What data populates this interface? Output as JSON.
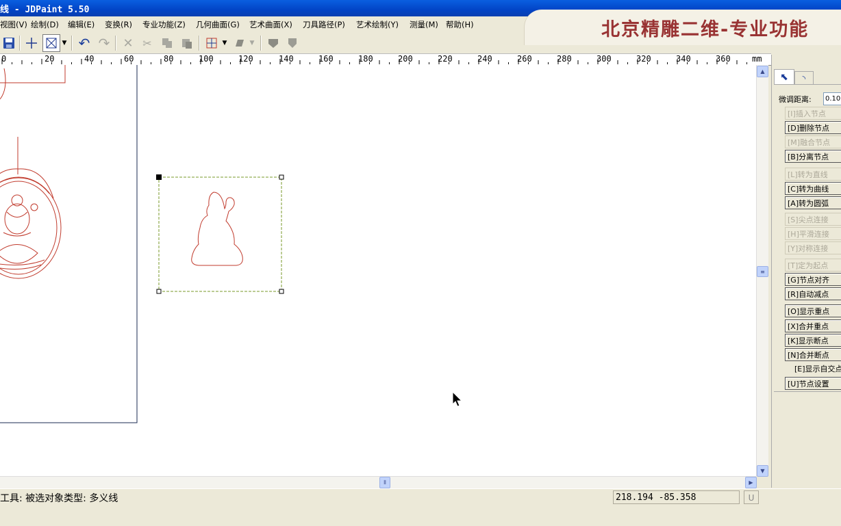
{
  "window": {
    "title": "线 - JDPaint 5.50"
  },
  "banner": {
    "text": "北京精雕二维-专业功能"
  },
  "menu": [
    {
      "label": "视图(V)"
    },
    {
      "label": "绘制(D)"
    },
    {
      "label": "编辑(E)"
    },
    {
      "label": "变换(R)"
    },
    {
      "label": "专业功能(Z)"
    },
    {
      "label": "几何曲面(G)"
    },
    {
      "label": "艺术曲面(X)"
    },
    {
      "label": "刀具路径(P)"
    },
    {
      "label": "艺术绘制(Y)"
    },
    {
      "label": "测量(M)"
    },
    {
      "label": "帮助(H)"
    }
  ],
  "toolbar": {
    "icons": [
      "save-icon",
      "crosshair-icon",
      "select-box-icon",
      "dropdown-arrow-icon",
      "undo-icon",
      "redo-icon",
      "delete-icon",
      "cut-icon",
      "copy-icon",
      "paste-icon",
      "grid-snap-icon",
      "fill-shape-icon",
      "node-edit-icon",
      "shield-icon"
    ]
  },
  "ruler": {
    "labels": [
      "0",
      "20",
      "40",
      "60",
      "80",
      "100",
      "120",
      "140",
      "160",
      "180",
      "200",
      "220",
      "240",
      "260",
      "280",
      "300",
      "320",
      "340",
      "360",
      "mm"
    ]
  },
  "panel": {
    "fine_tune_label": "微调距离:",
    "fine_tune_value": "0.10",
    "buttons": [
      {
        "label": "[I]插入节点",
        "enabled": false
      },
      {
        "label": "[D]删除节点",
        "enabled": true
      },
      {
        "label": "[M]融合节点",
        "enabled": false
      },
      {
        "label": "[B]分离节点",
        "enabled": true
      },
      {
        "label": "[L]转为直线",
        "enabled": false
      },
      {
        "label": "[C]转为曲线",
        "enabled": true
      },
      {
        "label": "[A]转为圆弧",
        "enabled": true
      },
      {
        "label": "[S]尖点连接",
        "enabled": false
      },
      {
        "label": "[H]平滑连接",
        "enabled": false
      },
      {
        "label": "[Y]对称连接",
        "enabled": false
      },
      {
        "label": "[T]定为起点",
        "enabled": false
      },
      {
        "label": "[G]节点对齐",
        "enabled": true
      },
      {
        "label": "[R]自动减点",
        "enabled": true
      },
      {
        "label": "[O]显示重点",
        "enabled": true
      },
      {
        "label": "[X]合并重点",
        "enabled": true
      },
      {
        "label": "[K]显示断点",
        "enabled": true
      },
      {
        "label": "[N]合并断点",
        "enabled": true
      },
      {
        "label": "[E]显示自交点",
        "enabled": true
      },
      {
        "label": "[U]节点设置",
        "enabled": true
      }
    ]
  },
  "status": {
    "text": "工具: 被选对象类型: 多义线",
    "coords": "218.194 -85.358",
    "unit_button": "U"
  },
  "colors": {
    "drawing": "#c0392b",
    "page_frame": "#1a2a50",
    "banner_text": "#993333"
  }
}
